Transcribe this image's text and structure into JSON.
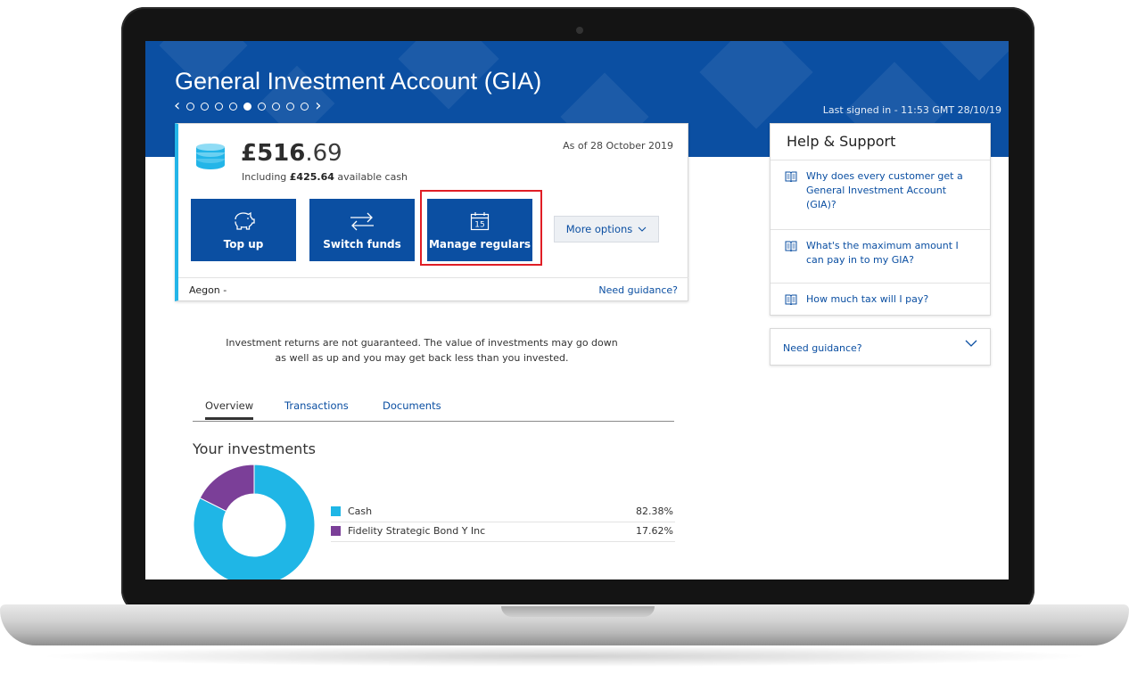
{
  "account": {
    "title": "General Investment Account (GIA)",
    "last_signed_in": "Last signed in - 11:53 GMT 28/10/19",
    "carousel": {
      "prev": "‹",
      "next": "›",
      "dots": 9,
      "active_index": 4
    },
    "balance_whole": "£516",
    "balance_pence": ".69",
    "cash_prefix": "Including ",
    "cash_amount": "£425.64",
    "cash_suffix": " available cash",
    "as_of": "As of 28 October 2019",
    "provider": "Aegon -",
    "need_guidance": "Need guidance?"
  },
  "actions": {
    "top_up": "Top up",
    "switch_funds": "Switch funds",
    "manage_regulars": "Manage regulars",
    "calendar_day": "15",
    "more_options": "More options"
  },
  "disclaimer": {
    "line1": "Investment returns are not guaranteed. The value of investments may go down",
    "line2": "as well as up and you may get back less than you invested."
  },
  "tabs": [
    "Overview",
    "Transactions",
    "Documents"
  ],
  "investments": {
    "title": "Your investments",
    "holdings": [
      {
        "name": "Cash",
        "percent": "82.38%",
        "value": 82.38,
        "color": "#1fb6e6"
      },
      {
        "name": "Fidelity Strategic Bond Y Inc",
        "percent": "17.62%",
        "value": 17.62,
        "color": "#7b3f98"
      }
    ]
  },
  "help": {
    "title": "Help & Support",
    "items": [
      "Why does every customer get a General Investment Account (GIA)?",
      "What's the maximum amount I can pay in to my GIA?",
      "How much tax will I pay?"
    ],
    "guidance_label": "Need guidance?"
  },
  "colors": {
    "brand": "#0b4fa2",
    "accent": "#23b5e8",
    "highlight": "#e01e26"
  }
}
